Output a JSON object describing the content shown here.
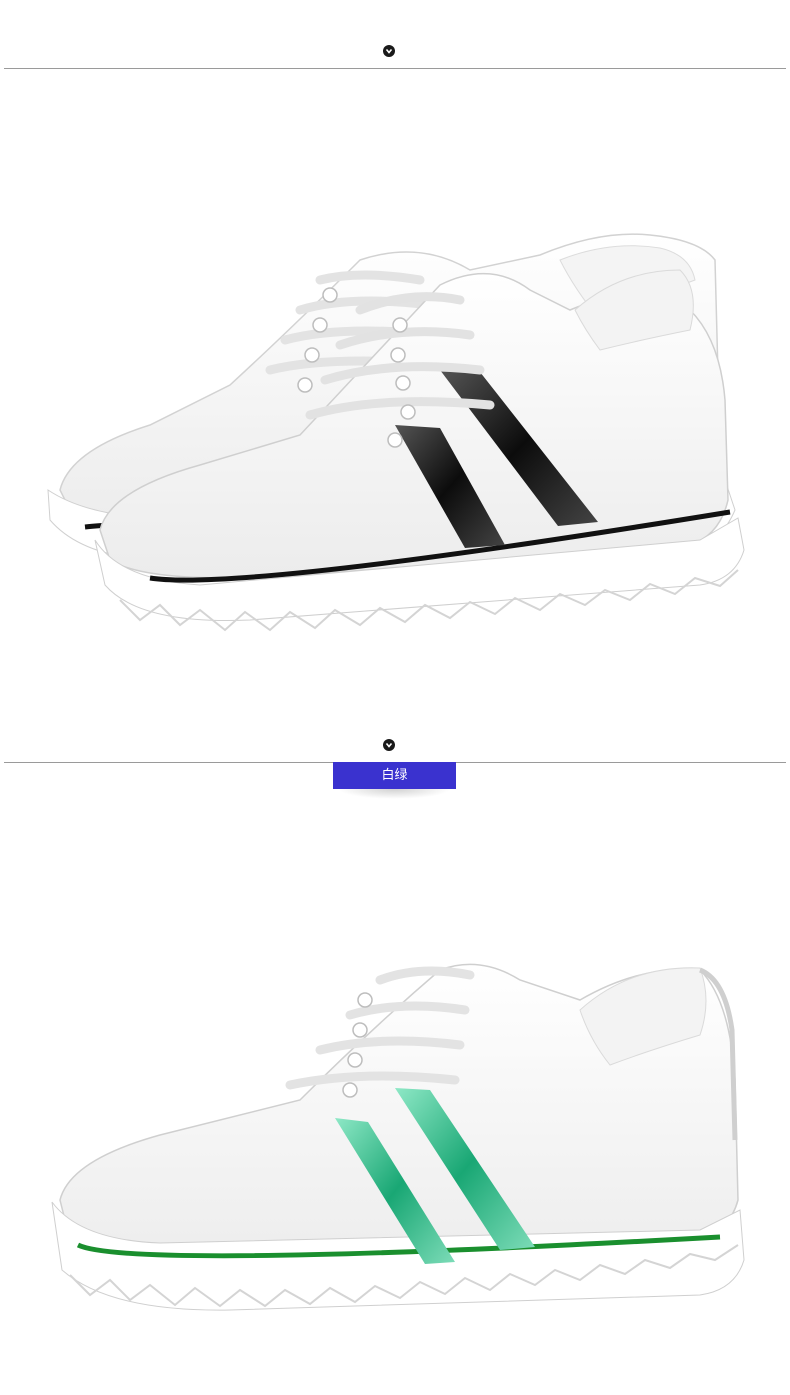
{
  "sections": [
    {
      "marker_icon": "chevron-down-icon",
      "image": "white-black-stripe-sneakers",
      "stripe_color": "#1c1c1c"
    },
    {
      "marker_icon": "chevron-down-icon",
      "color_tag": "白绿",
      "tag_color": "#3a32cf",
      "image": "white-green-stripe-sneaker",
      "stripe_color": "#2bb884",
      "sole_line_color": "#1a8f2e"
    }
  ]
}
